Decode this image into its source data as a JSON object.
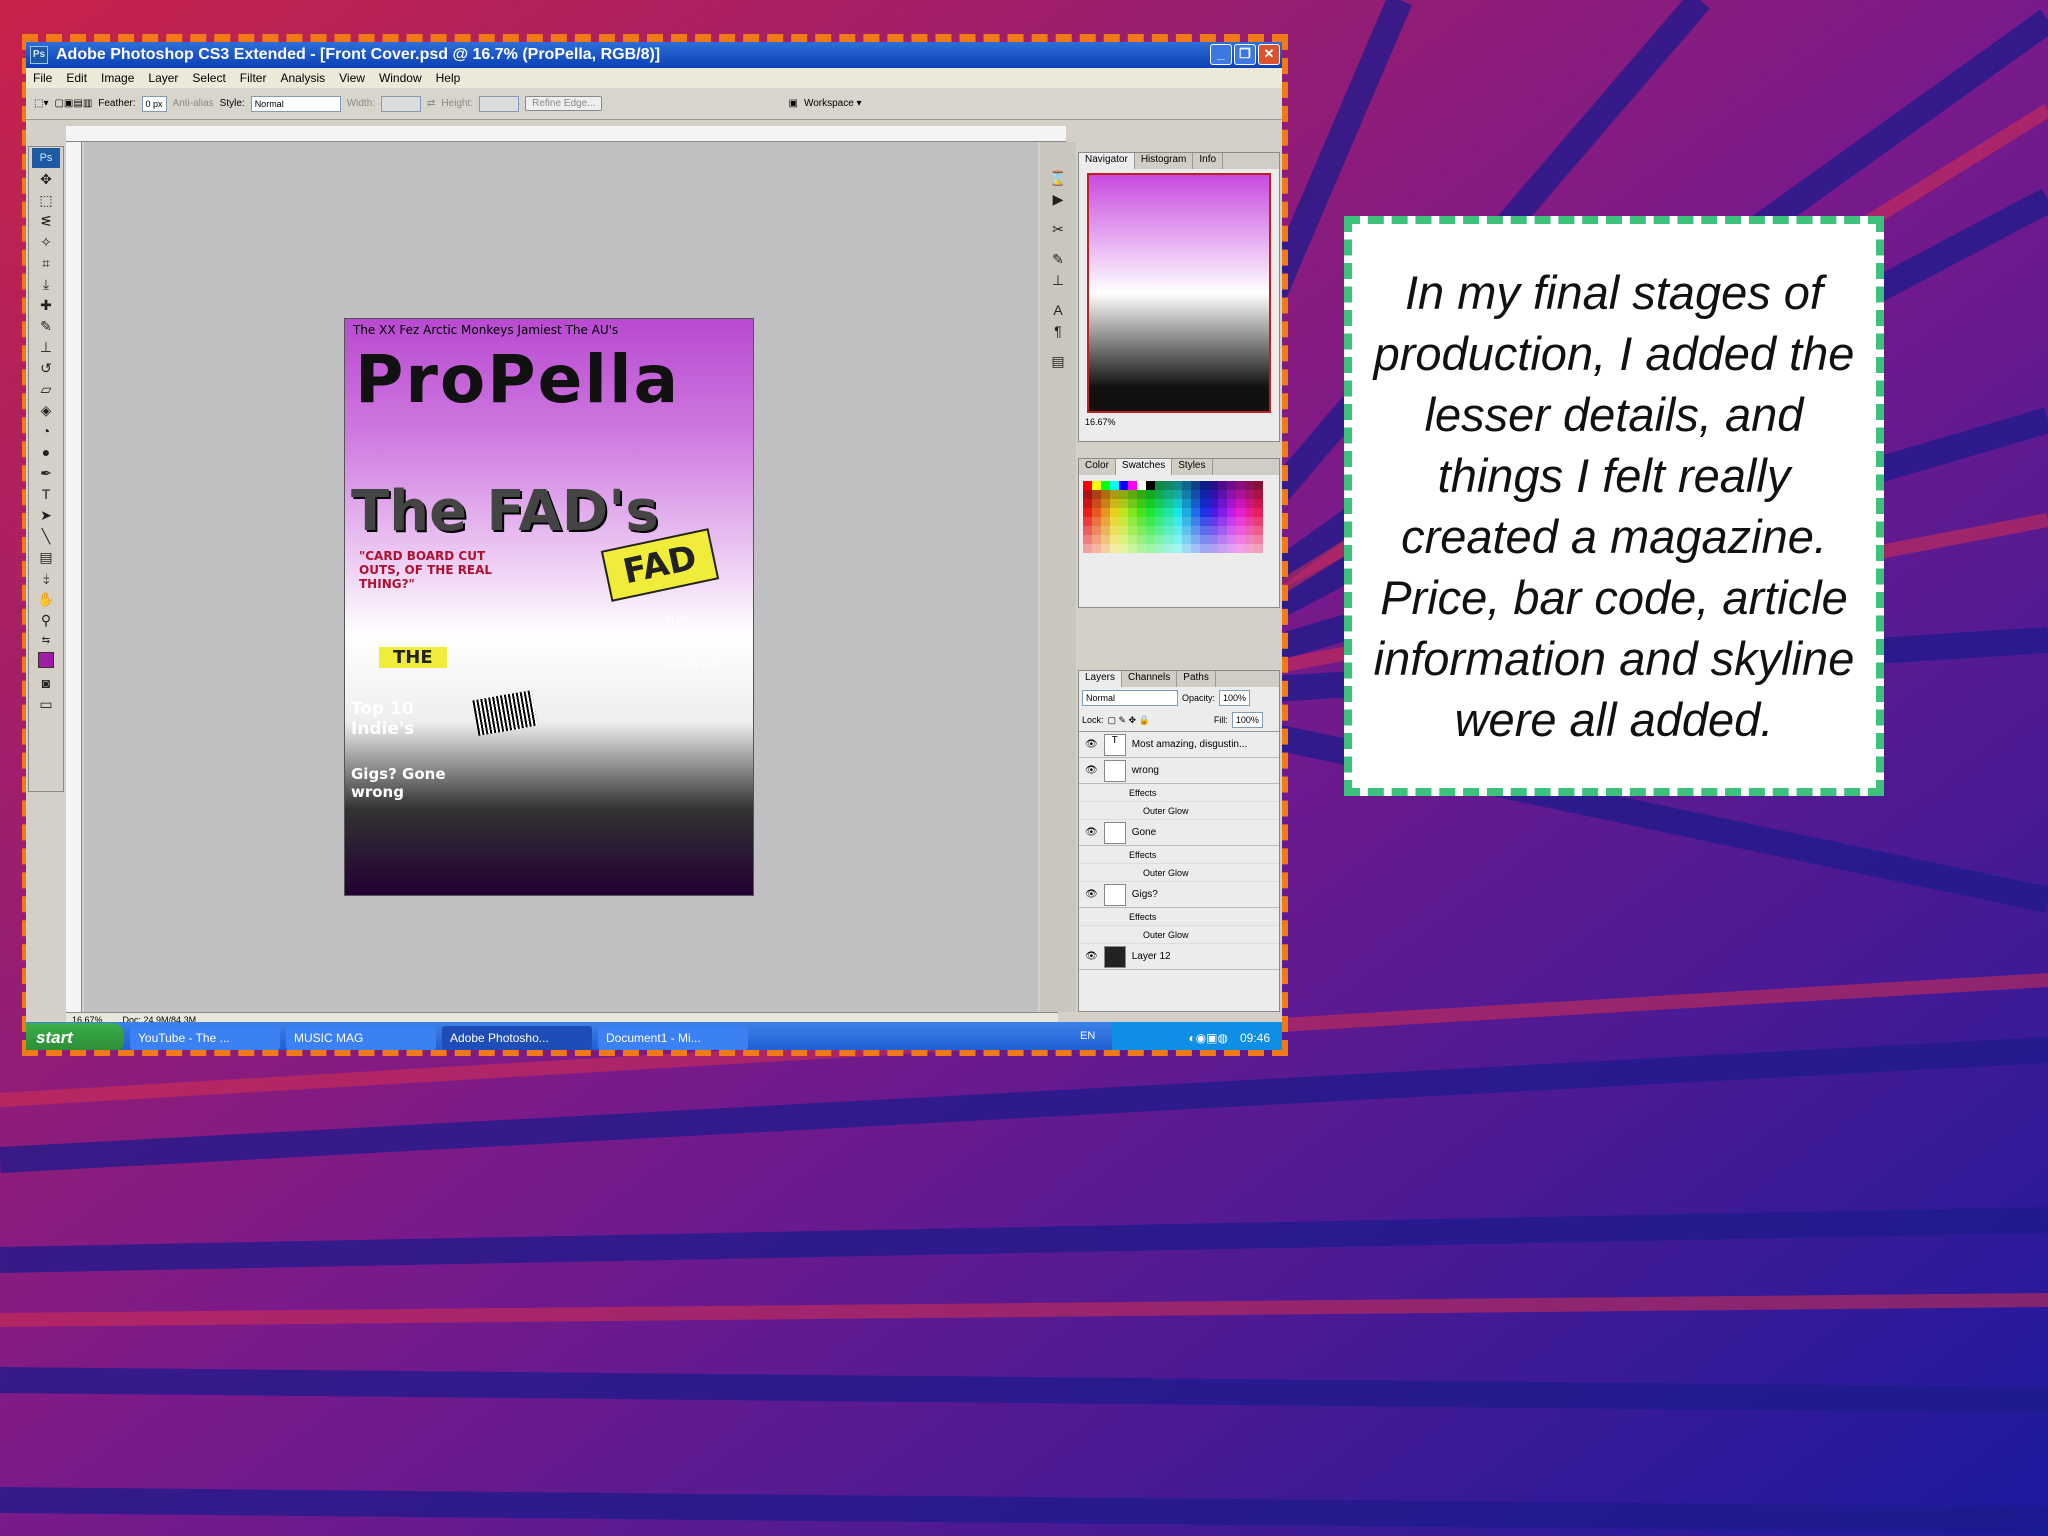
{
  "window": {
    "title": "Adobe Photoshop CS3 Extended - [Front Cover.psd @ 16.7% (ProPella, RGB/8)]",
    "app_icon": "Ps"
  },
  "menu": [
    "File",
    "Edit",
    "Image",
    "Layer",
    "Select",
    "Filter",
    "Analysis",
    "View",
    "Window",
    "Help"
  ],
  "options": {
    "feather_label": "Feather:",
    "feather_value": "0 px",
    "antialias_label": "Anti-alias",
    "style_label": "Style:",
    "style_value": "Normal",
    "width_label": "Width:",
    "height_label": "Height:",
    "refine_edge": "Refine Edge...",
    "workspace": "Workspace ▾"
  },
  "document": {
    "top_names": "The XX Fez   Arctic Monkeys   Jamiest   The AU's",
    "masthead": "ProPella",
    "headline": "The FAD's",
    "fad_label": "FAD",
    "quote": "\"CARD BOARD CUT OUTS, OF THE REAL THING?\"",
    "plus": "PLUS... Interviews Voice/ers money O' events info",
    "top_label": "Top 10 Indie's",
    "gigs_label": "Gigs? Gone wrong",
    "the_label": "THE"
  },
  "status": {
    "zoom": "16.67%",
    "doc": "Doc: 24.9M/84.3M"
  },
  "navigator": {
    "tabs": [
      "Navigator",
      "Histogram",
      "Info"
    ],
    "zoom": "16.67%"
  },
  "color_panel": {
    "tabs": [
      "Color",
      "Swatches",
      "Styles"
    ]
  },
  "layers_panel": {
    "tabs": [
      "Layers",
      "Channels",
      "Paths"
    ],
    "blend": "Normal",
    "opacity_label": "Opacity:",
    "opacity": "100%",
    "lock_label": "Lock:",
    "fill_label": "Fill:",
    "fill": "100%",
    "layers": [
      {
        "name": "Most amazing, disgustin..."
      },
      {
        "name": "wrong",
        "effects": "Effects",
        "effect": "Outer Glow"
      },
      {
        "name": "Gone",
        "effects": "Effects",
        "effect": "Outer Glow"
      },
      {
        "name": "Gigs?",
        "effects": "Effects",
        "effect": "Outer Glow"
      },
      {
        "name": "Layer 12"
      }
    ]
  },
  "taskbar": {
    "start": "start",
    "items": [
      "YouTube - The ...",
      "MUSIC MAG",
      "Adobe Photosho...",
      "Document1 - Mi..."
    ],
    "lang": "EN",
    "clock": "09:46"
  },
  "slide_text": "In my final stages of production, I added the lesser details, and things I felt really created a magazine. Price, bar code, article information and skyline were all added.",
  "colors": {
    "bg_red": "#c8234a",
    "bg_blue": "#1a1a9e",
    "frame_orange": "#f07a17",
    "box_green": "#3cc27a"
  }
}
